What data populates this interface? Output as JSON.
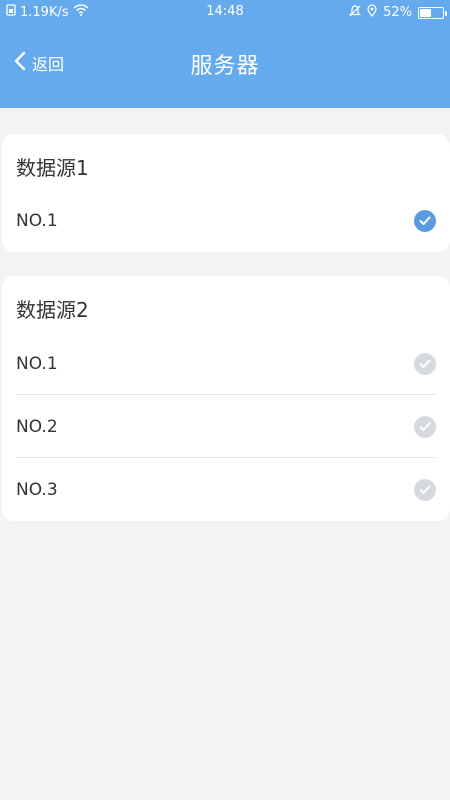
{
  "status_bar": {
    "speed": "1.19K/s",
    "time": "14:48",
    "battery": "52%",
    "battery_level": 0.52
  },
  "navbar": {
    "back_label": "返回",
    "title": "服务器"
  },
  "colors": {
    "header": "#66aaee",
    "check_selected": "#5b9be0",
    "check_unselected": "#d6d9de"
  },
  "sources": [
    {
      "title": "数据源1",
      "items": [
        {
          "label": "NO.1",
          "selected": true
        }
      ]
    },
    {
      "title": "数据源2",
      "items": [
        {
          "label": "NO.1",
          "selected": false
        },
        {
          "label": "NO.2",
          "selected": false
        },
        {
          "label": "NO.3",
          "selected": false
        }
      ]
    }
  ]
}
